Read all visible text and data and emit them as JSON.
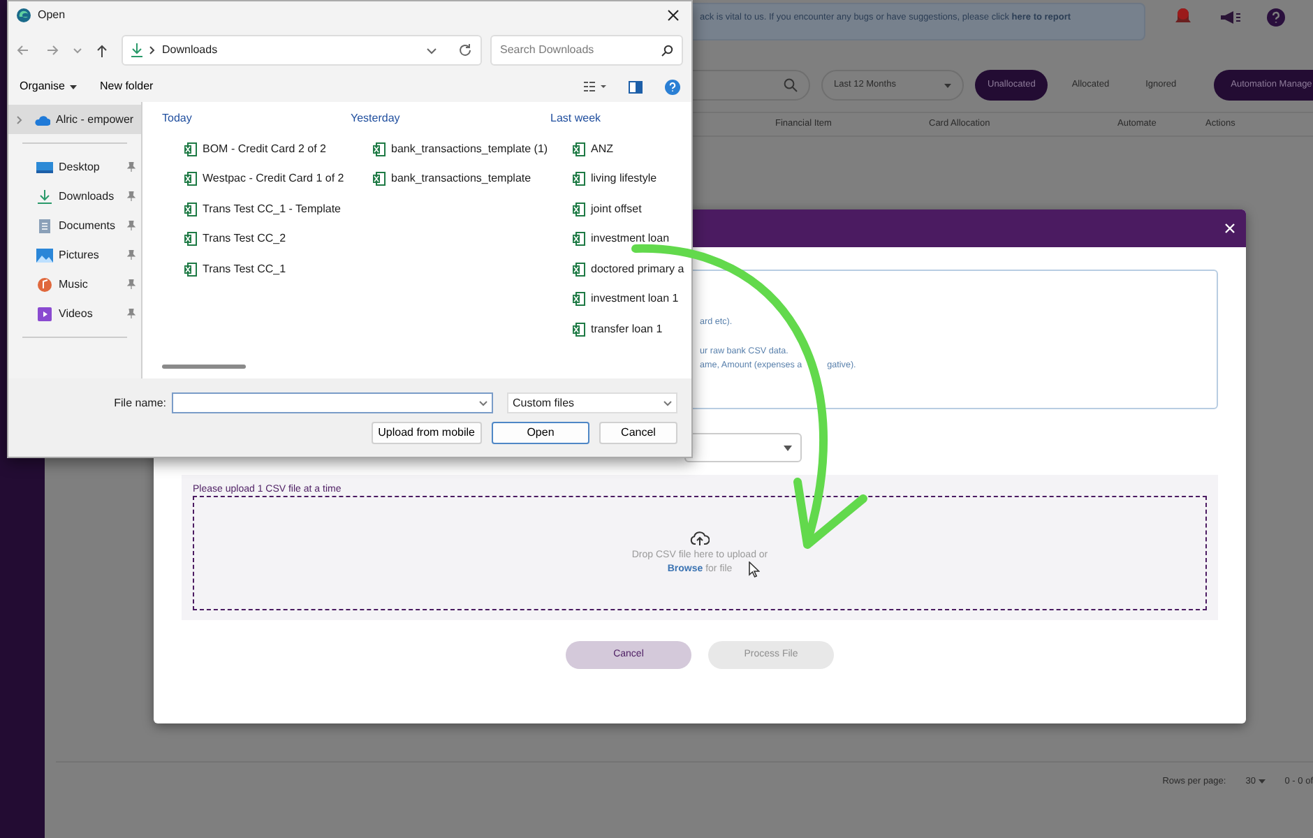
{
  "app": {
    "banner": {
      "text": "ack is vital to us. If you encounter any bugs or have suggestions, please click **here to report**"
    },
    "period": "Last 12 Months",
    "tabs": [
      {
        "label": "Unallocated",
        "selected": true
      },
      {
        "label": "Allocated",
        "selected": false
      },
      {
        "label": "Ignored",
        "selected": false
      }
    ],
    "automation_button": "Automation Manage",
    "columns": [
      "Financial Item",
      "Card Allocation",
      "Automate",
      "Actions"
    ],
    "pagination": {
      "rows_label": "Rows per page:",
      "rows_value": "30",
      "range": "0 - 0 of"
    }
  },
  "modal": {
    "info_lines": [
      [
        "ard etc)."
      ],
      [
        "ur raw bank CSV data."
      ],
      [
        "ame, Amount (expenses a",
        "gative)."
      ]
    ],
    "upload_label": "Please upload 1 CSV file at a time",
    "drop_text": "Drop CSV file here to upload or",
    "browse_text": "**Browse** for file",
    "buttons": [
      {
        "label": "Cancel",
        "disabled": false
      },
      {
        "label": "Process File",
        "disabled": true
      }
    ]
  },
  "dialog": {
    "title": "Open",
    "address": "Downloads",
    "search_placeholder": "Search Downloads",
    "toolbar": [
      {
        "label": "Organise",
        "dropdown": true
      },
      {
        "label": "New folder",
        "dropdown": false
      }
    ],
    "nav": [
      {
        "label": "Alric - empower",
        "kind": "cloud",
        "selected": true,
        "pinned": false
      },
      {
        "label": "Desktop",
        "kind": "desktop",
        "selected": false,
        "pinned": true
      },
      {
        "label": "Downloads",
        "kind": "downloads",
        "selected": false,
        "pinned": true
      },
      {
        "label": "Documents",
        "kind": "documents",
        "selected": false,
        "pinned": true
      },
      {
        "label": "Pictures",
        "kind": "pictures",
        "selected": false,
        "pinned": true
      },
      {
        "label": "Music",
        "kind": "music",
        "selected": false,
        "pinned": true
      },
      {
        "label": "Videos",
        "kind": "videos",
        "selected": false,
        "pinned": true
      }
    ],
    "groups": [
      {
        "heading": "Today",
        "files": [
          "BOM - Credit Card 2 of 2",
          "Westpac - Credit Card 1 of 2",
          "Trans Test CC_1 - Template",
          "Trans Test CC_2",
          "Trans Test CC_1"
        ]
      },
      {
        "heading": "Yesterday",
        "files": [
          "bank_transactions_template (1)",
          "bank_transactions_template"
        ]
      },
      {
        "heading": "Last week",
        "files": [
          "ANZ",
          "living lifestyle",
          "joint offset",
          "investment loan",
          "doctored primary a",
          "investment loan 1",
          "transfer loan 1"
        ]
      }
    ],
    "file_name_label": "File name:",
    "file_type": "Custom files",
    "buttons": [
      {
        "label": "Upload from mobile",
        "default": false
      },
      {
        "label": "Open",
        "default": true
      },
      {
        "label": "Cancel",
        "default": false
      }
    ]
  }
}
